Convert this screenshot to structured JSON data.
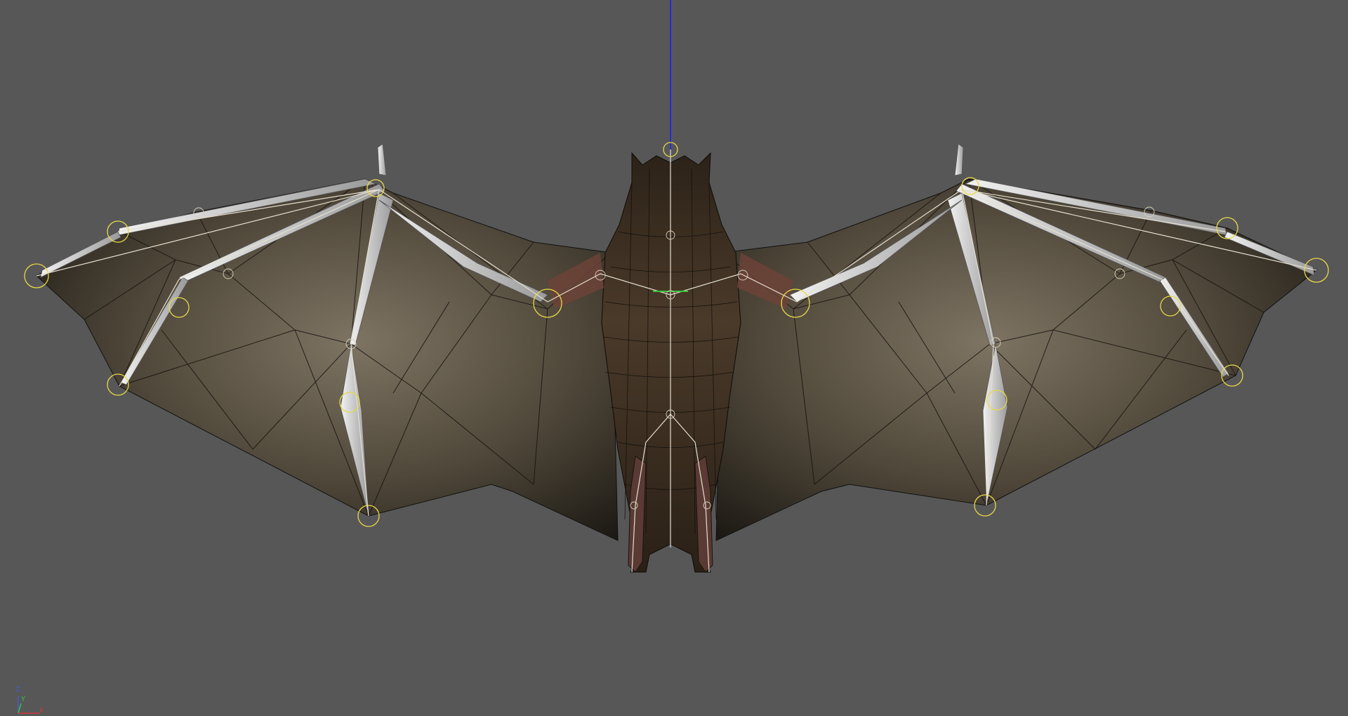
{
  "viewport": {
    "background": "#575757",
    "model": "bat",
    "view_up_axis_color": "#2a2ad6",
    "joint_ring_color": "#e8d84a"
  },
  "axis_gizmo": {
    "z_label": "Z",
    "y_label": "Y",
    "x_label": "X",
    "x_color": "#d23a3a",
    "y_color": "#3ac23a",
    "z_color": "#4a5ad8"
  }
}
